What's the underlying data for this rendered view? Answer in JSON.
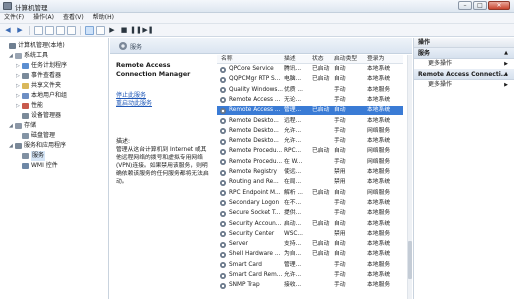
{
  "window": {
    "title": "计算机管理",
    "min": "–",
    "max": "□",
    "close": "✕"
  },
  "menu": [
    "文件(F)",
    "操作(A)",
    "查看(V)",
    "帮助(H)"
  ],
  "tree": [
    {
      "label": "计算机管理(本地)",
      "exp": "",
      "level": 0,
      "color": "#6f7f91"
    },
    {
      "label": "系统工具",
      "exp": "◢",
      "level": 1,
      "color": "#9aa5b3"
    },
    {
      "label": "任务计划程序",
      "exp": "▷",
      "level": 2,
      "color": "#5b8ed1"
    },
    {
      "label": "事件查看器",
      "exp": "▷",
      "level": 2,
      "color": "#7a8a9a"
    },
    {
      "label": "共享文件夹",
      "exp": "▷",
      "level": 2,
      "color": "#d9b75a"
    },
    {
      "label": "本地用户和组",
      "exp": "▷",
      "level": 2,
      "color": "#6c8ec4"
    },
    {
      "label": "性能",
      "exp": "▷",
      "level": 2,
      "color": "#c85a4c"
    },
    {
      "label": "设备管理器",
      "exp": "",
      "level": 2,
      "color": "#7b8a99"
    },
    {
      "label": "存储",
      "exp": "◢",
      "level": 1,
      "color": "#8c97a6"
    },
    {
      "label": "磁盘管理",
      "exp": "",
      "level": 2,
      "color": "#8494a5"
    },
    {
      "label": "服务和应用程序",
      "exp": "◢",
      "level": 1,
      "color": "#7a8898"
    },
    {
      "label": "服务",
      "exp": "",
      "level": 2,
      "color": "#8090a2",
      "selected": true
    },
    {
      "label": "WMI 控件",
      "exp": "",
      "level": 2,
      "color": "#6e88a6"
    }
  ],
  "services_header": "服务",
  "detail": {
    "name": "Remote Access Connection Manager",
    "stop_link": "停止此服务",
    "restart_link": "重启动此服务",
    "desc_label": "描述:",
    "desc_text": "管理从这台计算机到 Internet 或其他远程网络的拨号和虚拟专用网络(VPN)连接。如果禁用该服务，则明确依赖该服务的任何服务都将无法启动。"
  },
  "columns": [
    "名称",
    "描述",
    "状态",
    "启动类型",
    "登录为"
  ],
  "services": [
    [
      "QPCore Service",
      "腾讯...",
      "已启动",
      "自动",
      "本地系统"
    ],
    [
      "QQPCMgr RTP S...",
      "电脑...",
      "已启动",
      "自动",
      "本地系统"
    ],
    [
      "Quality Windows...",
      "优质 ...",
      "",
      "手动",
      "本地服务"
    ],
    [
      "Remote Access ...",
      "无论...",
      "",
      "手动",
      "本地系统"
    ],
    [
      "Remote Access ...",
      "管理...",
      "已启动",
      "自动",
      "本地系统"
    ],
    [
      "Remote Deskto...",
      "远程...",
      "",
      "手动",
      "本地系统"
    ],
    [
      "Remote Deskto...",
      "允许...",
      "",
      "手动",
      "网络服务"
    ],
    [
      "Remote Deskto...",
      "允许...",
      "",
      "手动",
      "本地系统"
    ],
    [
      "Remote Procedu...",
      "RPC...",
      "已启动",
      "自动",
      "网络服务"
    ],
    [
      "Remote Procedu...",
      "在 W...",
      "",
      "手动",
      "网络服务"
    ],
    [
      "Remote Registry",
      "使远...",
      "",
      "禁用",
      "本地服务"
    ],
    [
      "Routing and Re...",
      "在局...",
      "",
      "禁用",
      "本地系统"
    ],
    [
      "RPC Endpoint M...",
      "解析 ...",
      "已启动",
      "自动",
      "网络服务"
    ],
    [
      "Secondary Logon",
      "在不...",
      "",
      "手动",
      "本地系统"
    ],
    [
      "Secure Socket T...",
      "提供...",
      "",
      "手动",
      "本地服务"
    ],
    [
      "Security Accoun...",
      "启动...",
      "已启动",
      "自动",
      "本地系统"
    ],
    [
      "Security Center",
      "WSC...",
      "",
      "禁用",
      "本地服务"
    ],
    [
      "Server",
      "支持...",
      "已启动",
      "自动",
      "本地系统"
    ],
    [
      "Shell Hardware ...",
      "为自...",
      "已启动",
      "自动",
      "本地系统"
    ],
    [
      "Smart Card",
      "管理...",
      "",
      "手动",
      "本地服务"
    ],
    [
      "Smart Card Rem...",
      "允许...",
      "",
      "手动",
      "本地系统"
    ],
    [
      "SNMP Trap",
      "接收...",
      "",
      "手动",
      "本地服务"
    ]
  ],
  "selected_row": 4,
  "actions": {
    "title": "操作",
    "group1": "服务",
    "more1": "更多操作",
    "group2": "Remote Access Connecti...",
    "more2": "更多操作"
  }
}
